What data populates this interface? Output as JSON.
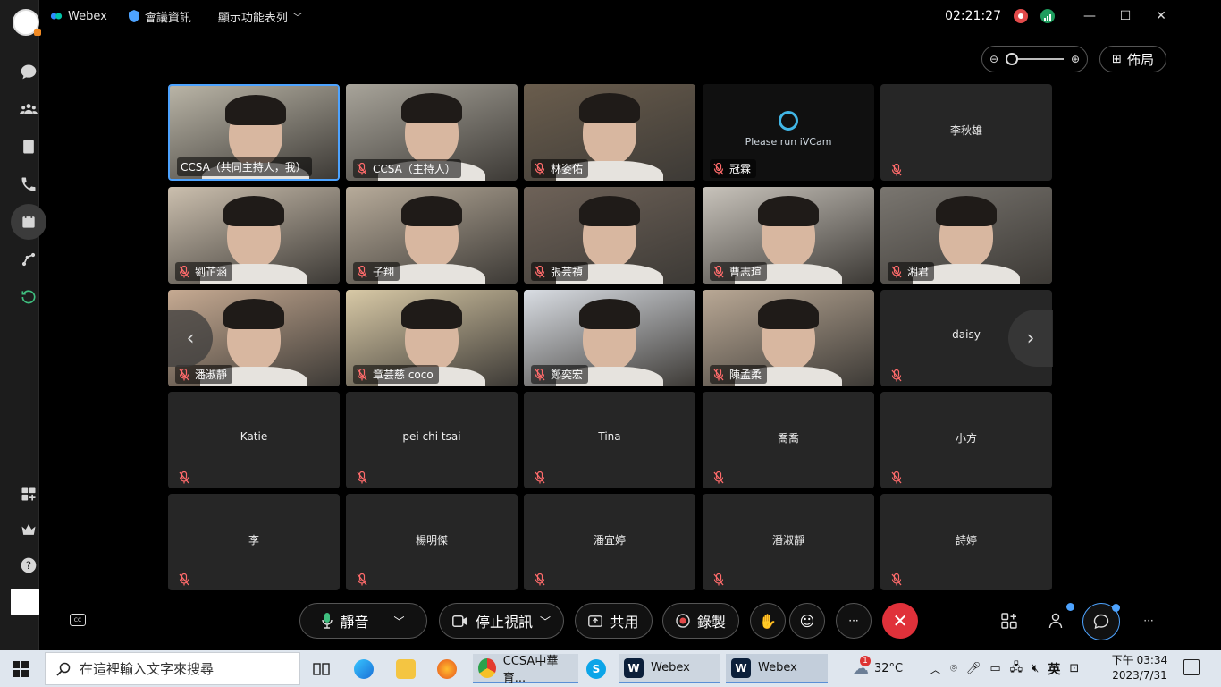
{
  "titlebar": {
    "app_name": "Webex",
    "meeting_info": "會議資訊",
    "view_menu": "顯示功能表列",
    "elapsed_time": "02:21:27"
  },
  "layout_button": "佈局",
  "zoom_level": 0.0,
  "tiles": [
    {
      "name": "CCSA（共同主持人，我）",
      "type": "video",
      "muted": false,
      "active": true,
      "bg": "#b9b4a6"
    },
    {
      "name": "CCSA（主持人）",
      "type": "video",
      "muted": true,
      "active": false,
      "bg": "#a8a49a"
    },
    {
      "name": "林姿佑",
      "type": "video",
      "muted": true,
      "active": false,
      "bg": "#6a5d4d"
    },
    {
      "name": "冠霖",
      "type": "ivcam",
      "muted": true,
      "active": false,
      "bg": "#101010",
      "overlay_text": "Please run iVCam"
    },
    {
      "name": "李秋雄",
      "type": "name",
      "muted": true,
      "active": false
    },
    {
      "name": "劉芷涵",
      "type": "video",
      "muted": true,
      "active": false,
      "bg": "#cbbfae"
    },
    {
      "name": "子翔",
      "type": "video",
      "muted": true,
      "active": false,
      "bg": "#b7ab9a"
    },
    {
      "name": "張芸禎",
      "type": "video",
      "muted": true,
      "active": false,
      "bg": "#6e6258"
    },
    {
      "name": "曹志瑄",
      "type": "video",
      "muted": true,
      "active": false,
      "bg": "#c8c3bb"
    },
    {
      "name": "湘君",
      "type": "video",
      "muted": true,
      "active": false,
      "bg": "#7a7670"
    },
    {
      "name": "潘淑靜",
      "type": "video",
      "muted": true,
      "active": false,
      "bg": "#c6aa92"
    },
    {
      "name": "章芸慈 coco",
      "type": "video",
      "muted": true,
      "active": false,
      "bg": "#d8c9a6"
    },
    {
      "name": "鄭奕宏",
      "type": "video",
      "muted": true,
      "active": false,
      "bg": "#d9dde3"
    },
    {
      "name": "陳孟柔",
      "type": "video",
      "muted": true,
      "active": false,
      "bg": "#b9a895"
    },
    {
      "name": "daisy",
      "type": "name",
      "muted": true,
      "active": false
    },
    {
      "name": "Katie",
      "type": "name",
      "muted": true,
      "active": false
    },
    {
      "name": "pei chi tsai",
      "type": "name",
      "muted": true,
      "active": false
    },
    {
      "name": "Tina",
      "type": "name",
      "muted": true,
      "active": false
    },
    {
      "name": "喬喬",
      "type": "name",
      "muted": true,
      "active": false
    },
    {
      "name": "小方",
      "type": "name",
      "muted": true,
      "active": false
    },
    {
      "name": "李",
      "type": "name",
      "muted": true,
      "active": false
    },
    {
      "name": "楊明傑",
      "type": "name",
      "muted": true,
      "active": false
    },
    {
      "name": "潘宜婷",
      "type": "name",
      "muted": true,
      "active": false
    },
    {
      "name": "潘淑靜",
      "type": "name",
      "muted": true,
      "active": false
    },
    {
      "name": "詩婷",
      "type": "name",
      "muted": true,
      "active": false
    }
  ],
  "controls": {
    "mute_label": "靜音",
    "stop_video_label": "停止視訊",
    "share_label": "共用",
    "record_label": "錄製",
    "more_label": "···"
  },
  "taskbar": {
    "search_placeholder": "在這裡輸入文字來搜尋",
    "chrome_label": "CCSA中華育...",
    "webex_label_1": "Webex",
    "webex_label_2": "Webex",
    "weather_temp": "32°C",
    "weather_badge": "1",
    "ime_label": "英",
    "clock_time": "下午 03:34",
    "clock_date": "2023/7/31"
  },
  "colors": {
    "end_call": "#e0313a",
    "active_border": "#4da3ff",
    "recording": "#e34b4b",
    "network": "#1e9d5e",
    "muted_icon": "#ff6b6b"
  }
}
